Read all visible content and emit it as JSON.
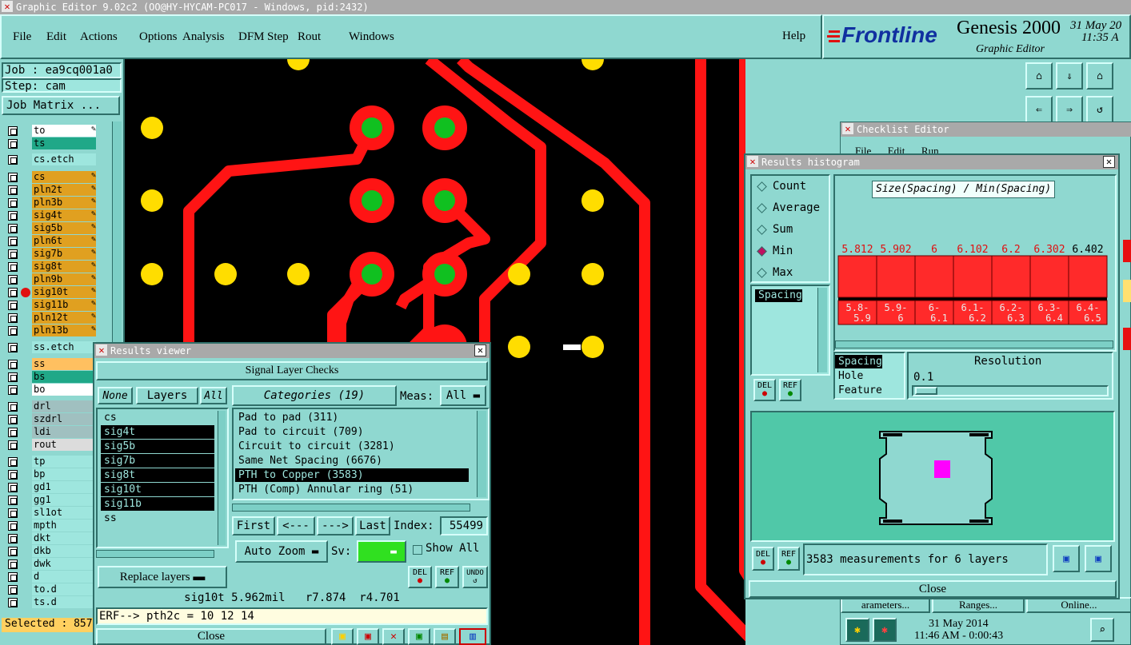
{
  "window": {
    "title": "Graphic Editor 9.02c2 (OO@HY-HYCAM-PC017 - Windows, pid:2432)"
  },
  "menu": [
    "File",
    "Edit",
    "Actions",
    "Options",
    "Analysis",
    "DFM",
    "Step",
    "Rout",
    "Windows"
  ],
  "help": "Help",
  "brand": {
    "name": "Frontline",
    "product": "Genesis 2000",
    "subtitle": "Graphic Editor",
    "date": "31 May 20",
    "time": "11:35 A"
  },
  "job": {
    "job": "Job : ea9cq001a0",
    "step": "Step: cam",
    "matrix": "Job Matrix ..."
  },
  "layers_top": [
    "to",
    "ts"
  ],
  "layers_etch": [
    "cs.etch"
  ],
  "layers_mid": [
    "cs",
    "pln2t",
    "pln3b",
    "sig4t",
    "sig5b",
    "pln6t",
    "sig7b",
    "sig8t",
    "pln9b",
    "sig10t",
    "sig11b",
    "pln12t",
    "pln13b"
  ],
  "layers_ss": [
    "ss.etch"
  ],
  "layers_bot": [
    "ss",
    "bs",
    "bo"
  ],
  "layers_drl": [
    "drl",
    "szdrl",
    "ldi",
    "rout"
  ],
  "layers_doc": [
    "tp",
    "bp",
    "gd1",
    "gg1",
    "sl1ot",
    "mpth",
    "dkt",
    "dkb",
    "dwk",
    "d",
    "to.d",
    "ts.d"
  ],
  "selected": "Selected : 857",
  "results_viewer": {
    "title": "Results viewer",
    "heading": "Signal Layer Checks",
    "none": "None",
    "layers": "Layers",
    "all": "All",
    "categories": "Categories (19)",
    "meas": "Meas:",
    "meas_value": "All",
    "layer_list": [
      "cs",
      "sig4t",
      "sig5b",
      "sig7b",
      "sig8t",
      "sig10t",
      "sig11b",
      "ss"
    ],
    "category_list": [
      "Pad to pad (311)",
      "Pad to circuit (709)",
      "Circuit to circuit (3281)",
      "Same Net Spacing (6676)",
      "PTH to Copper (3583)",
      "PTH (Comp) Annular ring (51)"
    ],
    "first": "First",
    "prev": "<---",
    "next": "--->",
    "last": "Last",
    "index_label": "Index:",
    "index_value": "55499",
    "auto_zoom": "Auto Zoom",
    "sv": "Sv:",
    "show_all": "Show All",
    "replace_layers": "Replace layers",
    "del": "DEL",
    "ref": "REF",
    "undo": "UNDO",
    "status": "sig10t 5.962mil   r7.874  r4.701",
    "erf": "ERF--> pth2c = 10 12 14",
    "close": "Close"
  },
  "checklist": {
    "title": "Checklist Editor",
    "menu": [
      "File",
      "Edit",
      "Run"
    ],
    "params": "arameters...",
    "ranges": "Ranges...",
    "online": "Online..."
  },
  "histogram": {
    "title": "Results histogram",
    "modes": [
      "Count",
      "Average",
      "Sum",
      "Min",
      "Max"
    ],
    "selected_mode": "Min",
    "chart_title": "Size(Spacing) / Min(Spacing)",
    "measure_list": [
      "Spacing"
    ],
    "resolution_list": [
      "Spacing",
      "Hole",
      "Feature"
    ],
    "resolution_label": "Resolution",
    "resolution_value": "0.1",
    "del": "DEL",
    "ref": "REF",
    "measurements": "3583 measurements for 6 layers",
    "close": "Close"
  },
  "chart_data": {
    "type": "bar",
    "title": "Size(Spacing) / Min(Spacing)",
    "categories": [
      "5.8-5.9",
      "5.9-6",
      "6-6.1",
      "6.1-6.2",
      "6.2-6.3",
      "6.3-6.4",
      "6.4-6.5"
    ],
    "values": [
      5.812,
      5.902,
      6,
      6.102,
      6.2,
      6.302,
      6.402
    ],
    "value_labels": [
      "5.812",
      "5.902",
      "6",
      "6.102",
      "6.2",
      "6.302",
      "6.402"
    ],
    "bar_color": "#ff2a2a"
  },
  "bottom_right": {
    "date": "31 May 2014",
    "time": "11:46 AM - 0:00:43"
  },
  "colors": {
    "panel": "#8fd8d0",
    "trace": "#ff1414",
    "pad": "#ffdd00",
    "via": "#10c020",
    "highlight": "#ff00ff"
  }
}
